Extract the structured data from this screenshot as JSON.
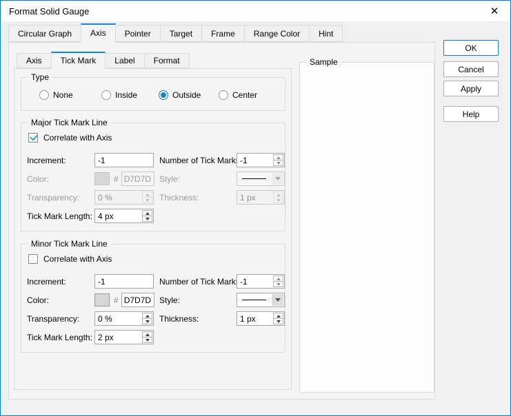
{
  "window": {
    "title": "Format Solid Gauge",
    "close_icon": "✕"
  },
  "main_tabs": [
    {
      "label": "Circular Graph",
      "selected": false
    },
    {
      "label": "Axis",
      "selected": true
    },
    {
      "label": "Pointer",
      "selected": false
    },
    {
      "label": "Target",
      "selected": false
    },
    {
      "label": "Frame",
      "selected": false
    },
    {
      "label": "Range Color",
      "selected": false
    },
    {
      "label": "Hint",
      "selected": false
    }
  ],
  "sub_tabs": [
    {
      "label": "Axis",
      "selected": false
    },
    {
      "label": "Tick Mark",
      "selected": true
    },
    {
      "label": "Label",
      "selected": false
    },
    {
      "label": "Format",
      "selected": false
    }
  ],
  "type_group": {
    "title": "Type",
    "options": [
      {
        "label": "None",
        "selected": false
      },
      {
        "label": "Inside",
        "selected": false
      },
      {
        "label": "Outside",
        "selected": true
      },
      {
        "label": "Center",
        "selected": false
      }
    ]
  },
  "major": {
    "title": "Major Tick Mark Line",
    "correlate_label": "Correlate with Axis",
    "correlate_checked": true,
    "increment_label": "Increment:",
    "increment_value": "-1",
    "num_ticks_label": "Number of Tick Marks:",
    "num_ticks_value": "-1",
    "color_label": "Color:",
    "color_hash": "#",
    "color_value": "D7D7D7",
    "color_swatch": "#D7D7D7",
    "color_disabled": true,
    "style_label": "Style:",
    "style_disabled": true,
    "transparency_label": "Transparency:",
    "transparency_value": "0 %",
    "transparency_disabled": true,
    "thickness_label": "Thickness:",
    "thickness_value": "1 px",
    "thickness_disabled": true,
    "length_label": "Tick Mark Length:",
    "length_value": "4 px"
  },
  "minor": {
    "title": "Minor Tick Mark Line",
    "correlate_label": "Correlate with Axis",
    "correlate_checked": false,
    "increment_label": "Increment:",
    "increment_value": "-1",
    "num_ticks_label": "Number of Tick Marks:",
    "num_ticks_value": "-1",
    "color_label": "Color:",
    "color_hash": "#",
    "color_value": "D7D7D7",
    "color_swatch": "#D7D7D7",
    "color_disabled": false,
    "style_label": "Style:",
    "style_disabled": false,
    "transparency_label": "Transparency:",
    "transparency_value": "0 %",
    "transparency_disabled": false,
    "thickness_label": "Thickness:",
    "thickness_value": "1 px",
    "thickness_disabled": false,
    "length_label": "Tick Mark Length:",
    "length_value": "2 px"
  },
  "sample_group": {
    "title": "Sample"
  },
  "buttons": {
    "ok": "OK",
    "cancel": "Cancel",
    "apply": "Apply",
    "help": "Help"
  },
  "colors": {
    "accent": "#0078d7",
    "tab_highlight": "#1583d5",
    "radio_selected": "#1583c7",
    "checkbox_check": "#2b9fd8",
    "swatch_fill": "#d7d7d7",
    "disabled_text": "#9a9a9a",
    "dialog_bg": "#f0f0f0",
    "titlebar_bg": "#ffffff"
  }
}
